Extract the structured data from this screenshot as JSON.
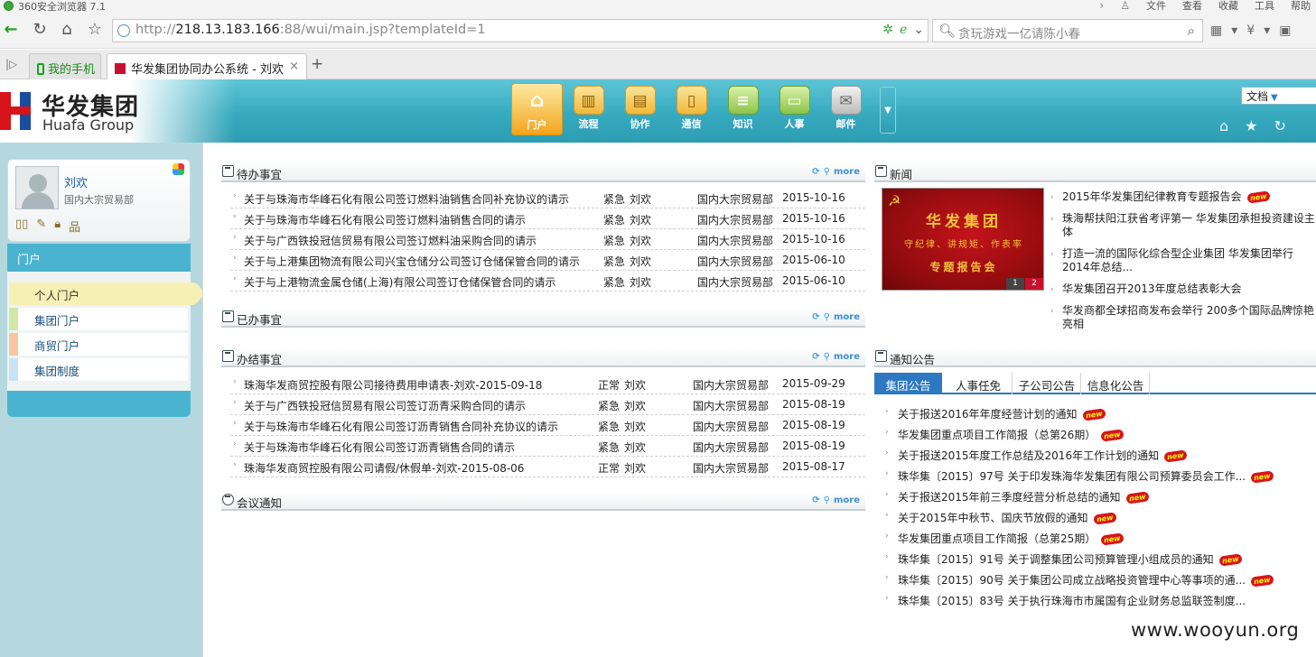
{
  "browser": {
    "app_title": "360安全浏览器 7.1",
    "menus": [
      "文件",
      "查看",
      "收藏",
      "工具",
      "帮助"
    ],
    "url_prefix": "http://",
    "url_host": "218.13.183.166",
    "url_rest": ":88/wui/main.jsp?templateId=1",
    "search_placeholder": "贪玩游戏一亿请陈小春",
    "tabs": [
      {
        "label": "我的手机"
      },
      {
        "label": "华发集团协同办公系统 - 刘欢"
      }
    ],
    "close_glyph": "×",
    "new_tab_glyph": "+"
  },
  "header": {
    "logo_cn": "华发集团",
    "logo_en": "Huafa Group",
    "modules": [
      {
        "label": "门户",
        "icon": "home-icon",
        "glyph": "⌂"
      },
      {
        "label": "流程",
        "icon": "chart-icon",
        "glyph": "▥"
      },
      {
        "label": "协作",
        "icon": "clipboard-icon",
        "glyph": "▤"
      },
      {
        "label": "通信",
        "icon": "phone-icon",
        "glyph": "▯"
      },
      {
        "label": "知识",
        "icon": "database-icon",
        "glyph": "≡"
      },
      {
        "label": "人事",
        "icon": "id-card-icon",
        "glyph": "▭"
      },
      {
        "label": "邮件",
        "icon": "mail-icon",
        "glyph": "✉"
      }
    ],
    "search_scope": "文档"
  },
  "user": {
    "name": "刘欢",
    "dept": "国内大宗贸易部"
  },
  "sidebar": {
    "menu_title": "门户",
    "items": [
      {
        "label": "个人门户",
        "color": "#f7f0b4"
      },
      {
        "label": "集团门户",
        "color": "#cfe8a6"
      },
      {
        "label": "商贸门户",
        "color": "#f7c7a3"
      },
      {
        "label": "集团制度",
        "color": "#c7e3f3"
      }
    ]
  },
  "more_label": "more",
  "todo": {
    "title": "待办事宜",
    "rows": [
      {
        "title": "关于与珠海市华峰石化有限公司签订燃料油销售合同补充协议的请示",
        "level": "紧急",
        "user": "刘欢",
        "dept": "国内大宗贸易部",
        "date": "2015-10-16"
      },
      {
        "title": "关于与珠海市华峰石化有限公司签订燃料油销售合同的请示",
        "level": "紧急",
        "user": "刘欢",
        "dept": "国内大宗贸易部",
        "date": "2015-10-16"
      },
      {
        "title": "关于与广西铁投冠信贸易有限公司签订燃料油采购合同的请示",
        "level": "紧急",
        "user": "刘欢",
        "dept": "国内大宗贸易部",
        "date": "2015-10-16"
      },
      {
        "title": "关于与上港集团物流有限公司兴宝仓储分公司签订仓储保管合同的请示",
        "level": "紧急",
        "user": "刘欢",
        "dept": "国内大宗贸易部",
        "date": "2015-06-10"
      },
      {
        "title": "关于与上港物流金属仓储(上海)有限公司签订仓储保管合同的请示",
        "level": "紧急",
        "user": "刘欢",
        "dept": "国内大宗贸易部",
        "date": "2015-06-10"
      }
    ]
  },
  "done": {
    "title": "已办事宜"
  },
  "finished": {
    "title": "办结事宜",
    "rows": [
      {
        "title": "珠海华发商贸控股有限公司接待费用申请表-刘欢-2015-09-18",
        "level": "正常",
        "user": "刘欢",
        "dept": "国内大宗贸易部",
        "date": "2015-09-29"
      },
      {
        "title": "关于与广西铁投冠信贸易有限公司签订沥青采购合同的请示",
        "level": "紧急",
        "user": "刘欢",
        "dept": "国内大宗贸易部",
        "date": "2015-08-19"
      },
      {
        "title": "关于与珠海市华峰石化有限公司签订沥青销售合同补充协议的请示",
        "level": "紧急",
        "user": "刘欢",
        "dept": "国内大宗贸易部",
        "date": "2015-08-19"
      },
      {
        "title": "关于与珠海市华峰石化有限公司签订沥青销售合同的请示",
        "level": "紧急",
        "user": "刘欢",
        "dept": "国内大宗贸易部",
        "date": "2015-08-19"
      },
      {
        "title": "珠海华发商贸控股有限公司请假/休假单-刘欢-2015-08-06",
        "level": "正常",
        "user": "刘欢",
        "dept": "国内大宗贸易部",
        "date": "2015-08-17"
      }
    ]
  },
  "meeting": {
    "title": "会议通知"
  },
  "news": {
    "title": "新闻",
    "image_text": [
      "华发集团",
      "守纪律、讲规矩、作表率",
      "专题报告会"
    ],
    "pager": [
      "1",
      "2"
    ],
    "items": [
      {
        "text": "2015年华发集团纪律教育专题报告会",
        "is_new": true
      },
      {
        "text": "珠海帮扶阳江获省考评第一 华发集团承担投资建设主体",
        "is_new": false
      },
      {
        "text": "打造一流的国际化综合型企业集团 华发集团举行2014年总结...",
        "is_new": false
      },
      {
        "text": "华发集团召开2013年度总结表彰大会",
        "is_new": false
      },
      {
        "text": "华发商都全球招商发布会举行 200多个国际品牌惊艳亮相",
        "is_new": false
      }
    ]
  },
  "notices": {
    "title": "通知公告",
    "tabs": [
      "集团公告",
      "人事任免",
      "子公司公告",
      "信息化公告"
    ],
    "new_badge": "new",
    "items": [
      {
        "text": "关于报送2016年年度经营计划的通知",
        "is_new": true
      },
      {
        "text": "华发集团重点项目工作简报（总第26期）",
        "is_new": true
      },
      {
        "text": "关于报送2015年度工作总结及2016年工作计划的通知",
        "is_new": true
      },
      {
        "text": "珠华集〔2015〕97号 关于印发珠海华发集团有限公司预算委员会工作...",
        "is_new": true
      },
      {
        "text": "关于报送2015年前三季度经营分析总结的通知",
        "is_new": true
      },
      {
        "text": "关于2015年中秋节、国庆节放假的通知",
        "is_new": true
      },
      {
        "text": "华发集团重点项目工作简报（总第25期）",
        "is_new": true
      },
      {
        "text": "珠华集〔2015〕91号 关于调整集团公司预算管理小组成员的通知",
        "is_new": true
      },
      {
        "text": "珠华集〔2015〕90号 关于集团公司成立战略投资管理中心等事项的通...",
        "is_new": true
      },
      {
        "text": "珠华集〔2015〕83号 关于执行珠海市市属国有企业财务总监联签制度...",
        "is_new": false
      }
    ]
  },
  "watermark": "www.wooyun.org"
}
